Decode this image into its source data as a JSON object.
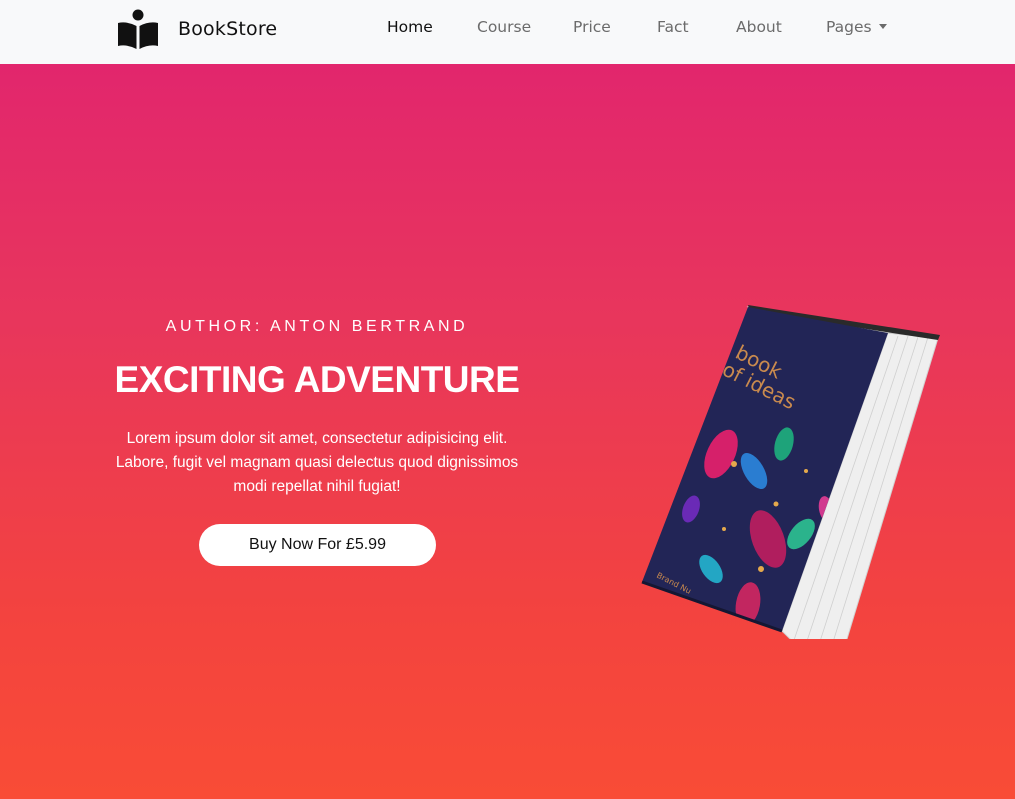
{
  "navbar": {
    "brand_name": "BookStore",
    "brand_icon": "book-reader-icon",
    "links": [
      {
        "label": "Home",
        "active": true
      },
      {
        "label": "Course",
        "active": false
      },
      {
        "label": "Price",
        "active": false
      },
      {
        "label": "Fact",
        "active": false
      },
      {
        "label": "About",
        "active": false
      },
      {
        "label": "Pages",
        "active": false,
        "dropdown": true
      }
    ]
  },
  "hero": {
    "author": "AUTHOR: ANTON BERTRAND",
    "title": "EXCITING ADVENTURE",
    "description_lines": [
      "Lorem ipsum dolor sit amet, consectetur adipisicing elit.",
      "Labore, fugit vel magnam quasi delectus quod dignissimos",
      "modi repellat nihil fugiat!"
    ],
    "button_label": "Buy Now For £5.99",
    "book_cover": {
      "title": "book of ideas",
      "author": "Brand Nu"
    }
  },
  "colors": {
    "navbar_bg": "#f8f9fa",
    "hero_gradient_top": "#e2266d",
    "hero_gradient_bottom": "#f94c36",
    "cover_bg": "#222556",
    "cover_text": "#c98a4e"
  }
}
